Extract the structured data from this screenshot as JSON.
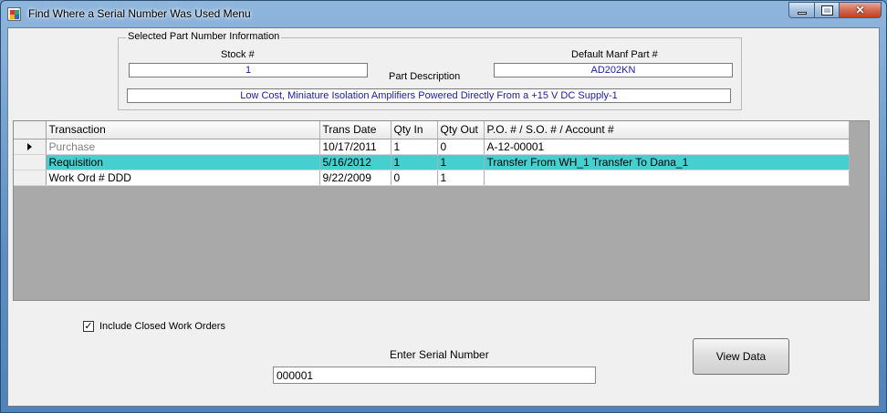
{
  "window": {
    "title": "Find Where a Serial Number Was Used Menu",
    "minimize_icon": "minimize-icon",
    "maximize_icon": "maximize-icon",
    "close_icon": "close-icon",
    "close_glyph": "✕"
  },
  "part_info": {
    "legend": "Selected Part Number Information",
    "stock_label": "Stock #",
    "stock_value": "1",
    "desc_label": "Part Description",
    "manf_label": "Default Manf Part #",
    "manf_value": "AD202KN",
    "description": "Low Cost, Miniature Isolation Amplifiers Powered Directly From a +15 V DC Supply-1"
  },
  "grid": {
    "columns": [
      "Transaction",
      "Trans Date",
      "Qty In",
      "Qty Out",
      "P.O. # / S.O. # / Account #"
    ],
    "rows": [
      [
        "Purchase",
        "10/17/2011",
        "1",
        "0",
        "A-12-00001"
      ],
      [
        "Requisition",
        "5/16/2012",
        "1",
        "1",
        "Transfer From WH_1 Transfer To Dana_1"
      ],
      [
        "Work Ord # DDD",
        "9/22/2009",
        "0",
        "1",
        ""
      ]
    ],
    "selected_row": 1,
    "current_row": 0
  },
  "options": {
    "include_closed_label": "Include Closed Work Orders",
    "include_closed_checked": true,
    "check_glyph": "✓"
  },
  "serial": {
    "label": "Enter Serial Number",
    "value": "000001"
  },
  "actions": {
    "view_data_label": "View Data"
  }
}
